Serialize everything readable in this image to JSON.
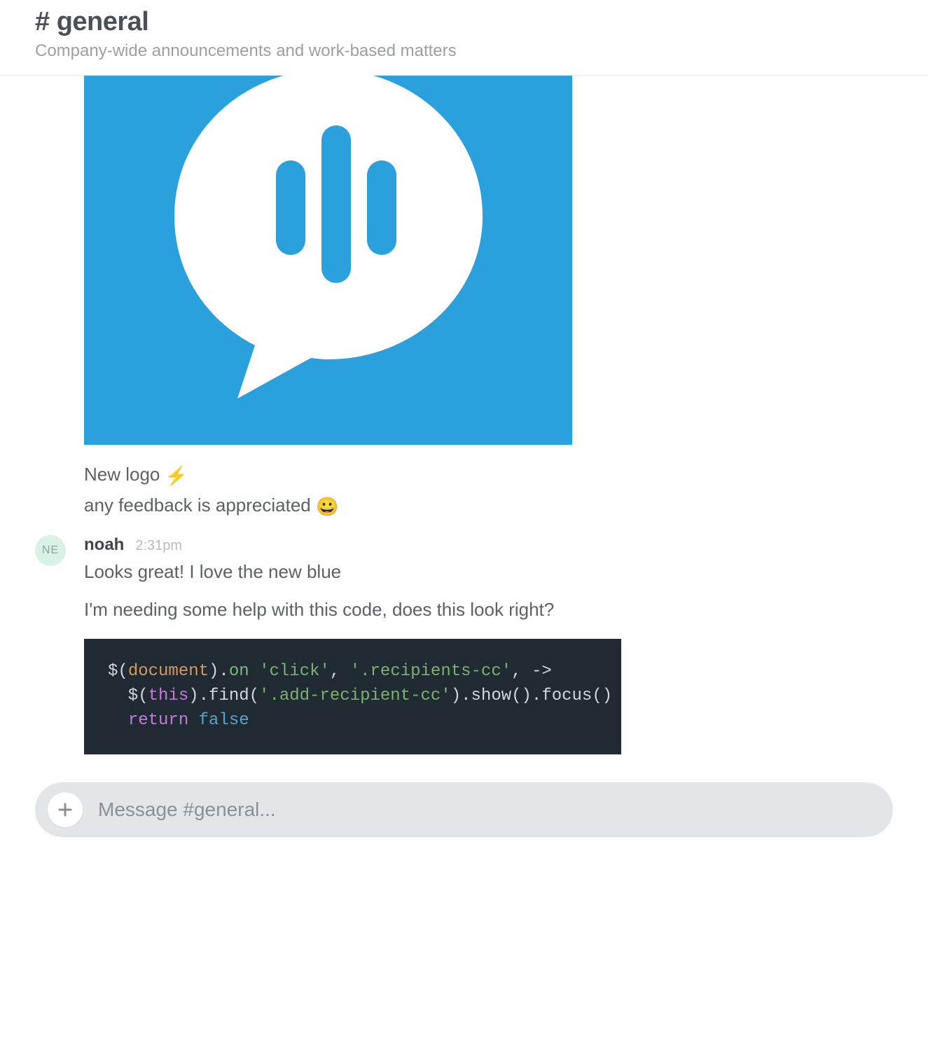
{
  "header": {
    "title": "# general",
    "topic": "Company-wide announcements and work-based matters"
  },
  "messages": {
    "m1": {
      "line1": "New logo ",
      "emoji1": "⚡",
      "line2": "any feedback is appreciated ",
      "emoji2": "😀"
    },
    "m2": {
      "author": "noah",
      "time": "2:31pm",
      "avatar_initials": "NE",
      "line1": "Looks great! I love the new blue",
      "line2": "I'm needing some help with this code, does this look right?",
      "code": {
        "t1": "$(",
        "t2": "document",
        "t3": ").",
        "t4": "on",
        "t5": " ",
        "t6": "'click'",
        "t7": ", ",
        "t8": "'.recipients-cc'",
        "t9": ", ",
        "t10": "->",
        "t11": "  $(",
        "t12": "this",
        "t13": ").find(",
        "t14": "'.add-recipient-cc'",
        "t15": ").show().focus()",
        "t16": "  ",
        "t17": "return",
        "t18": " ",
        "t19": "false"
      }
    }
  },
  "composer": {
    "placeholder": "Message #general..."
  },
  "colors": {
    "logo_bg": "#2aa0dc",
    "avatar_bg": "#d8f2e5",
    "code_bg": "#1f2a33"
  }
}
